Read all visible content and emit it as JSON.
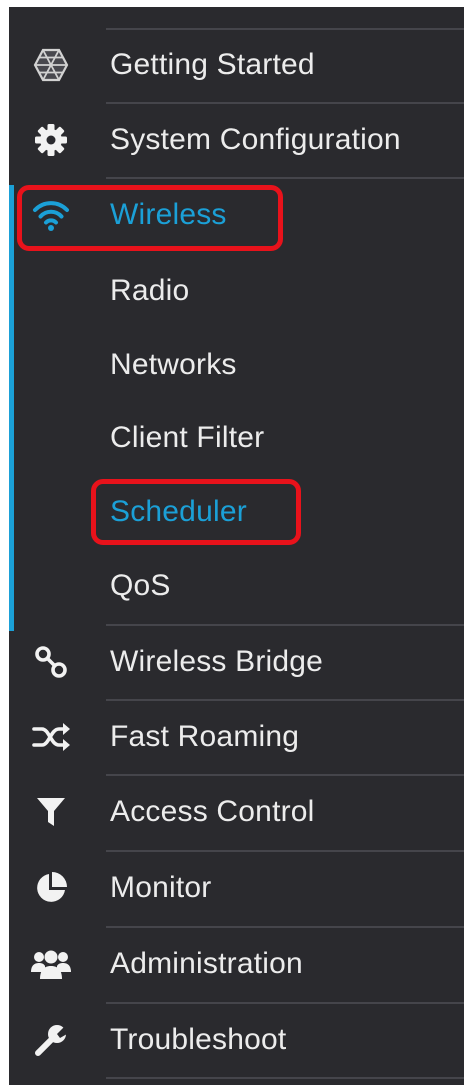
{
  "sidebar": {
    "items": [
      {
        "label": "Getting Started",
        "icon": "globe-icon"
      },
      {
        "label": "System Configuration",
        "icon": "gear-icon"
      },
      {
        "label": "Wireless",
        "icon": "wifi-icon",
        "active": true,
        "children": [
          {
            "label": "Radio"
          },
          {
            "label": "Networks"
          },
          {
            "label": "Client Filter"
          },
          {
            "label": "Scheduler",
            "active": true
          },
          {
            "label": "QoS"
          }
        ]
      },
      {
        "label": "Wireless Bridge",
        "icon": "link-icon"
      },
      {
        "label": "Fast Roaming",
        "icon": "shuffle-icon"
      },
      {
        "label": "Access Control",
        "icon": "filter-icon"
      },
      {
        "label": "Monitor",
        "icon": "pie-chart-icon"
      },
      {
        "label": "Administration",
        "icon": "users-icon"
      },
      {
        "label": "Troubleshoot",
        "icon": "wrench-icon"
      }
    ]
  },
  "colors": {
    "background": "#2a2a2e",
    "text": "#ececec",
    "accent": "#1ba0d7",
    "highlight": "#e8121b",
    "divider": "#45454b"
  }
}
